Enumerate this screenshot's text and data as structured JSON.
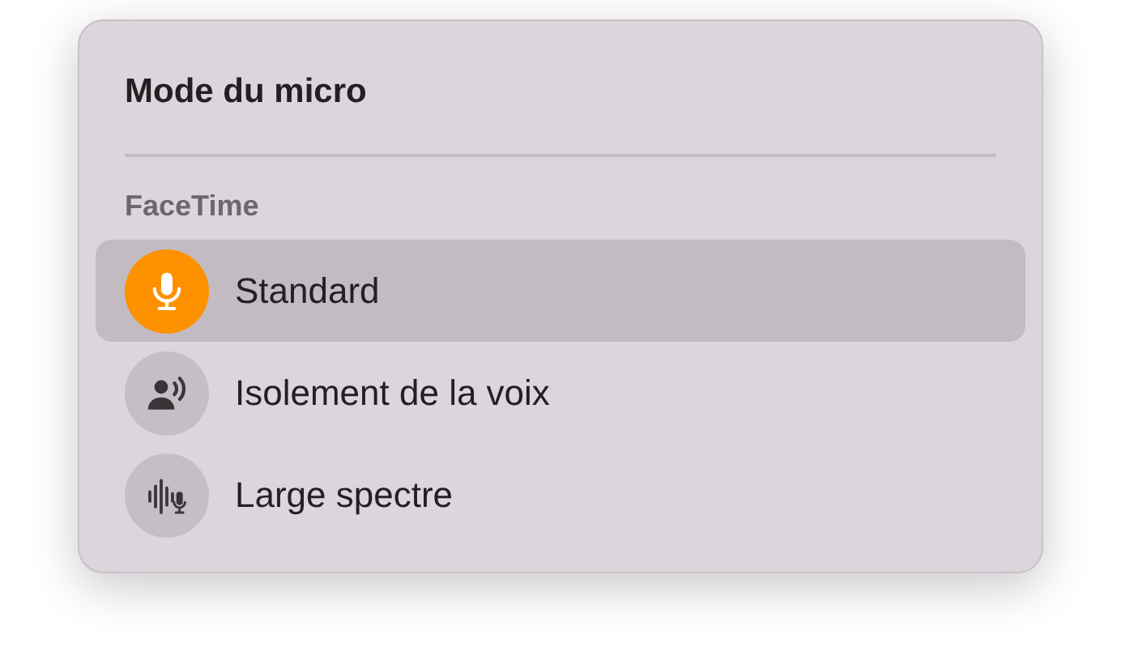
{
  "title": "Mode du micro",
  "section": "FaceTime",
  "modes": [
    {
      "kind": "microphone",
      "label": "Standard",
      "selected": true
    },
    {
      "kind": "voice",
      "label": "Isolement de la voix",
      "selected": false
    },
    {
      "kind": "wide",
      "label": "Large spectre",
      "selected": false
    }
  ]
}
